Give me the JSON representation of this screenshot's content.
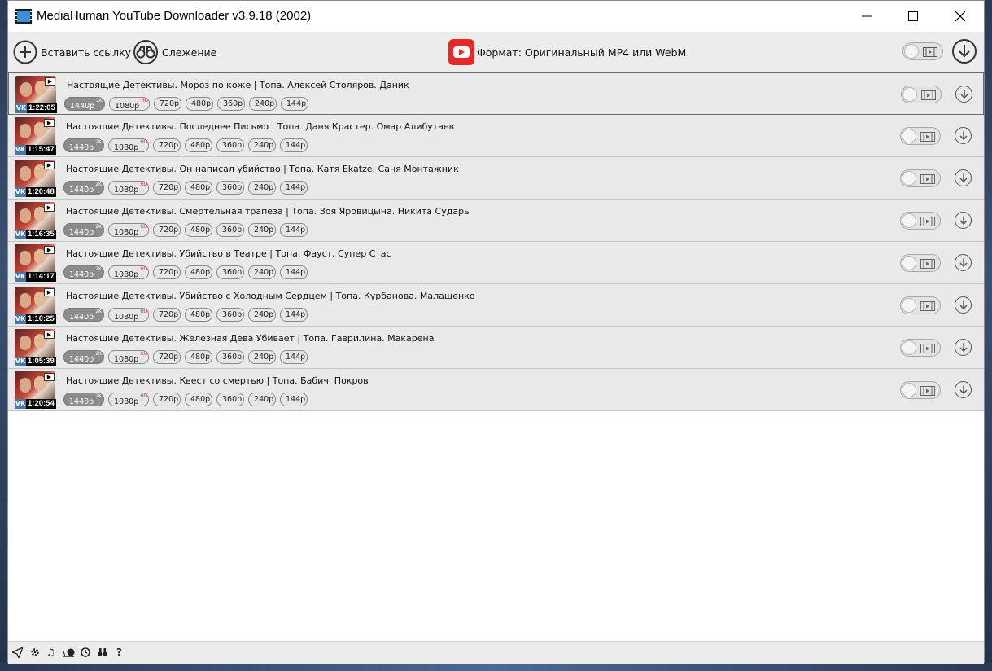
{
  "window": {
    "title": "MediaHuman YouTube Downloader v3.9.18 (2002)"
  },
  "toolbar": {
    "paste_label": "Вставить ссылку",
    "tracking_label": "Слежение",
    "format_label": "Формат: Оригинальный MP4 или WebM"
  },
  "quality": {
    "q1440": "1440p",
    "badge_2k": "2K",
    "q1080": "1080p",
    "badge_hd": "HD",
    "q720": "720p",
    "q480": "480p",
    "q360": "360p",
    "q240": "240p",
    "q144": "144p"
  },
  "thumb": {
    "source_badge": "VK"
  },
  "rows": [
    {
      "title": "Настоящие Детективы. Мороз по коже | Топа. Алексей Столяров. Даник",
      "duration": "1:22:05",
      "selected_quality": "1440p"
    },
    {
      "title": "Настоящие Детективы. Последнее Письмо | Топа. Даня Крастер. Омар Алибутаев",
      "duration": "1:15:47",
      "selected_quality": "1440p"
    },
    {
      "title": "Настоящие Детективы. Он написал убийство | Топа. Катя Ekatze. Саня Монтажник",
      "duration": "1:20:48",
      "selected_quality": "1440p"
    },
    {
      "title": "Настоящие Детективы. Смертельная трапеза | Топа. Зоя Яровицына. Никита Сударь",
      "duration": "1:16:35",
      "selected_quality": "1440p"
    },
    {
      "title": "Настоящие Детективы. Убийство в Театре | Топа. Фауст. Супер Стас",
      "duration": "1:14:17",
      "selected_quality": "1440p"
    },
    {
      "title": "Настоящие Детективы. Убийство с Холодным Сердцем | Топа. Курбанова. Малащенко",
      "duration": "1:10:25",
      "selected_quality": "1440p"
    },
    {
      "title": "Настоящие Детективы. Железная Дева Убивает | Топа. Гаврилина. Макарена",
      "duration": "1:05:39",
      "selected_quality": "1440p"
    },
    {
      "title": "Настоящие Детективы. Квест со смертью | Топа. Бабич. Покров",
      "duration": "1:20:54",
      "selected_quality": "1440p"
    }
  ],
  "statusbar": {
    "help_label": "?"
  },
  "icons": [
    "app-icon",
    "minimize-icon",
    "maximize-icon",
    "close-icon",
    "plus-circle-icon",
    "binoculars-icon",
    "youtube-icon",
    "video-toggle-icon",
    "download-icon",
    "send-icon",
    "gear-icon",
    "music-icon",
    "snail-icon",
    "clock-icon",
    "binoculars-small-icon",
    "help-icon"
  ]
}
